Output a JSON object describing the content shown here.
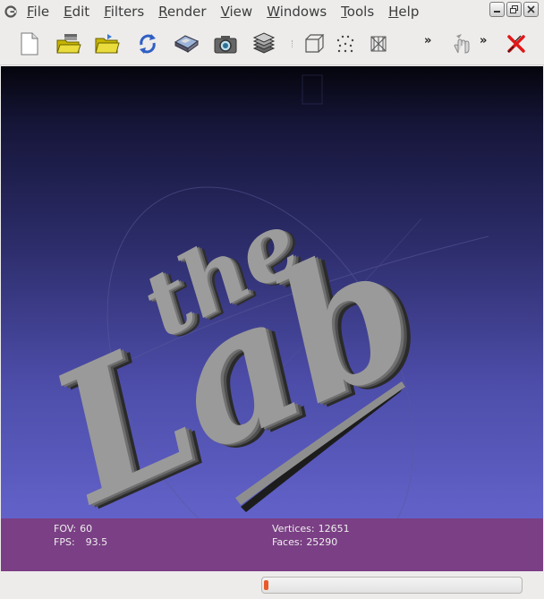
{
  "window": {
    "menu": [
      "File",
      "Edit",
      "Filters",
      "Render",
      "View",
      "Windows",
      "Tools",
      "Help"
    ]
  },
  "toolbar": {
    "buttons": [
      "new-document-icon",
      "open-project-icon",
      "open-file-icon",
      "reload-icon",
      "save-icon",
      "snapshot-camera-icon",
      "layers-icon",
      "bounding-box-icon",
      "points-icon",
      "wireframe-icon",
      "manipulator-icon",
      "delete-icon"
    ]
  },
  "viewport": {
    "model_text": [
      "the",
      "Lab"
    ],
    "fov_label": "FOV:",
    "fov": "60",
    "fps_label": "FPS:",
    "fps": "93.5",
    "vertices_label": "Vertices:",
    "vertices": "12651",
    "faces_label": "Faces:",
    "faces": "25290"
  },
  "status": {
    "progress": 0.01
  },
  "colors": {
    "background_top": "#05050d",
    "background_bottom": "#6a6ad6",
    "info_panel": "#7a3f84",
    "model": "#9a9a9a",
    "progress_fill": "#e85a2a"
  }
}
